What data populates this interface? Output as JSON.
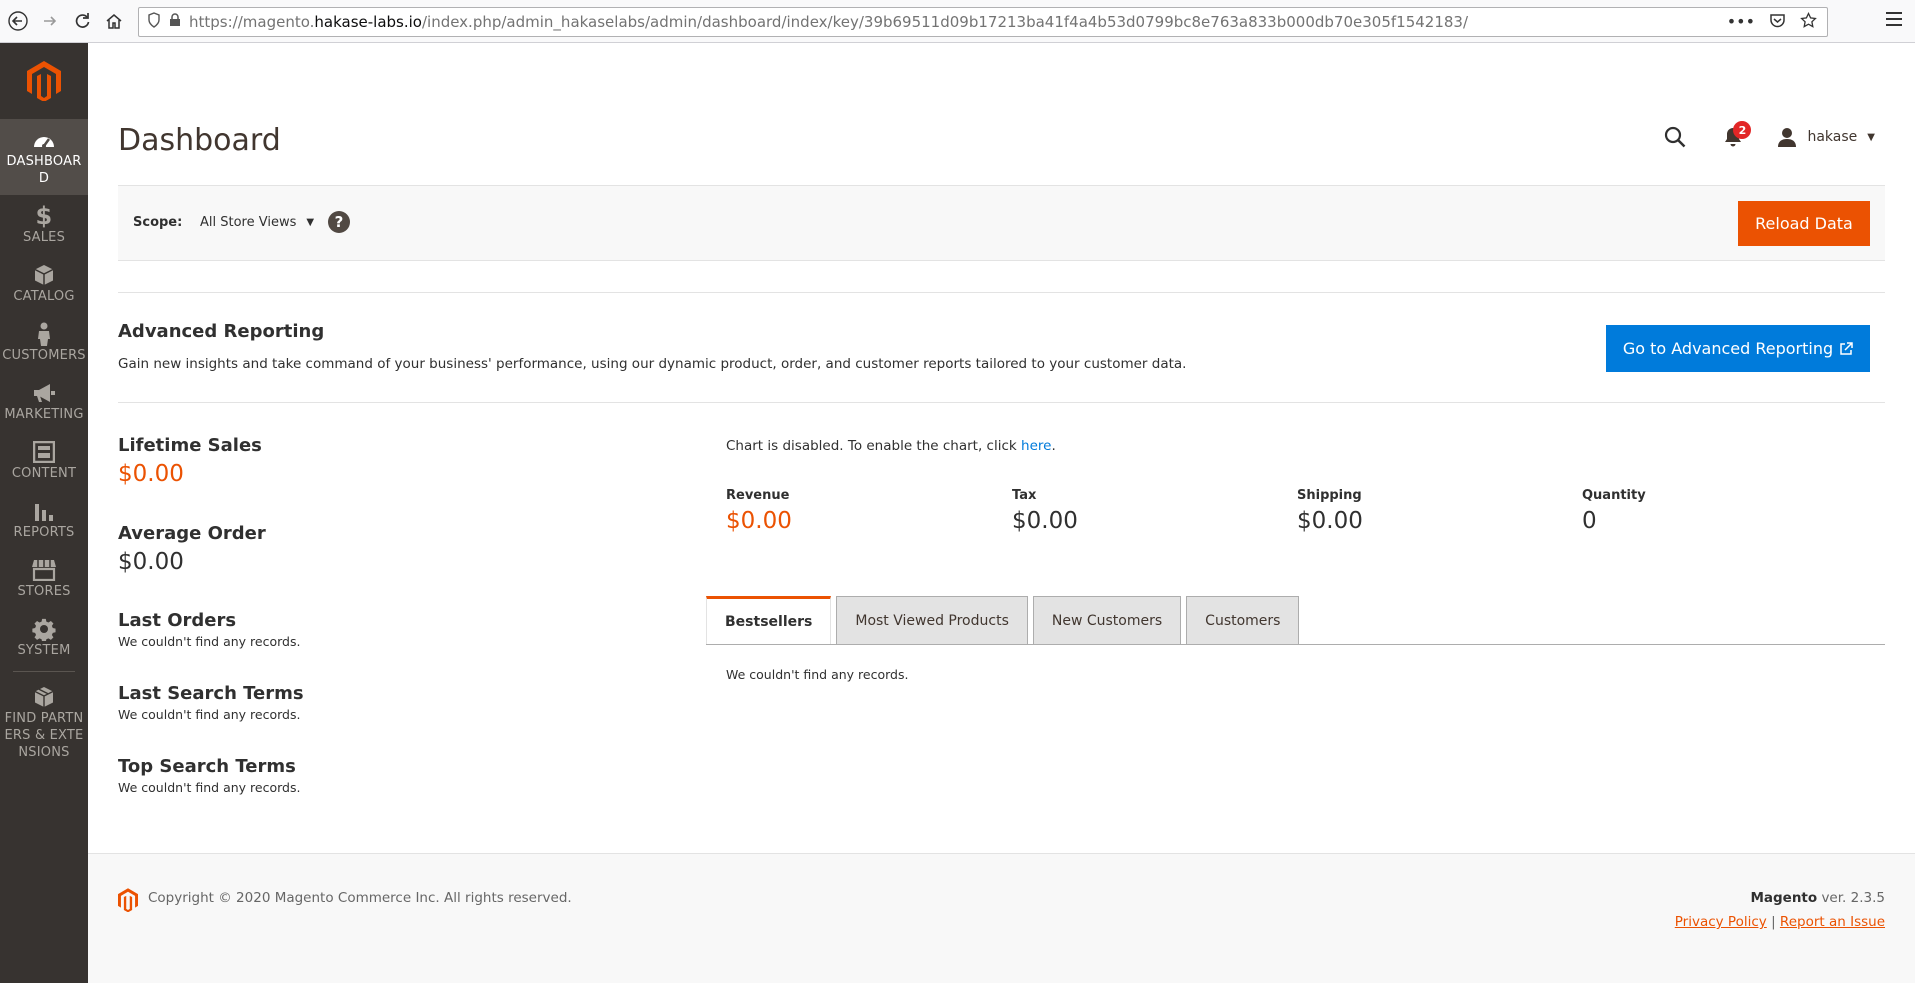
{
  "browser": {
    "url_prefix": "https://magento.",
    "url_host": "hakase-labs.io",
    "url_path": "/index.php/admin_hakaselabs/admin/dashboard/index/key/39b69511d09b17213ba41f4a4b53d0799bc8e763a833b000db70e305f1542183/"
  },
  "sidebar": {
    "items": [
      {
        "label": "DASHBOARD",
        "icon": "dashboard-icon"
      },
      {
        "label": "SALES",
        "icon": "dollar-icon"
      },
      {
        "label": "CATALOG",
        "icon": "box-icon"
      },
      {
        "label": "CUSTOMERS",
        "icon": "person-icon"
      },
      {
        "label": "MARKETING",
        "icon": "megaphone-icon"
      },
      {
        "label": "CONTENT",
        "icon": "layout-icon"
      },
      {
        "label": "REPORTS",
        "icon": "bar-chart-icon"
      },
      {
        "label": "STORES",
        "icon": "storefront-icon"
      },
      {
        "label": "SYSTEM",
        "icon": "gear-icon"
      },
      {
        "label": "FIND PARTNERS & EXTENSIONS",
        "icon": "cube-icon"
      }
    ]
  },
  "header": {
    "title": "Dashboard",
    "notifications_count": "2",
    "username": "hakase"
  },
  "scope": {
    "label": "Scope:",
    "value": "All Store Views",
    "help": "?",
    "reload_label": "Reload Data"
  },
  "advanced_reporting": {
    "title": "Advanced Reporting",
    "description": "Gain new insights and take command of your business' performance, using our dynamic product, order, and customer reports tailored to your customer data.",
    "button_label": "Go to Advanced Reporting"
  },
  "stats": {
    "lifetime_sales_title": "Lifetime Sales",
    "lifetime_sales_value": "$0.00",
    "average_order_title": "Average Order",
    "average_order_value": "$0.00",
    "last_orders_title": "Last Orders",
    "last_orders_empty": "We couldn't find any records.",
    "last_search_title": "Last Search Terms",
    "last_search_empty": "We couldn't find any records.",
    "top_search_title": "Top Search Terms",
    "top_search_empty": "We couldn't find any records."
  },
  "chart": {
    "message": "Chart is disabled. To enable the chart, click ",
    "link": "here",
    "period": "."
  },
  "totals": {
    "revenue_label": "Revenue",
    "revenue_value": "$0.00",
    "tax_label": "Tax",
    "tax_value": "$0.00",
    "shipping_label": "Shipping",
    "shipping_value": "$0.00",
    "quantity_label": "Quantity",
    "quantity_value": "0"
  },
  "tabs": {
    "items": [
      "Bestsellers",
      "Most Viewed Products",
      "New Customers",
      "Customers"
    ],
    "active": "Bestsellers",
    "content": "We couldn't find any records."
  },
  "footer": {
    "copyright": "Copyright © 2020 Magento Commerce Inc. All rights reserved.",
    "brand": "Magento",
    "version": " ver. 2.3.5",
    "privacy": "Privacy Policy",
    "divider": " | ",
    "report": "Report an Issue"
  },
  "colors": {
    "accent": "#eb5202",
    "primary_button": "#007bdb",
    "sidebar": "#373330"
  }
}
